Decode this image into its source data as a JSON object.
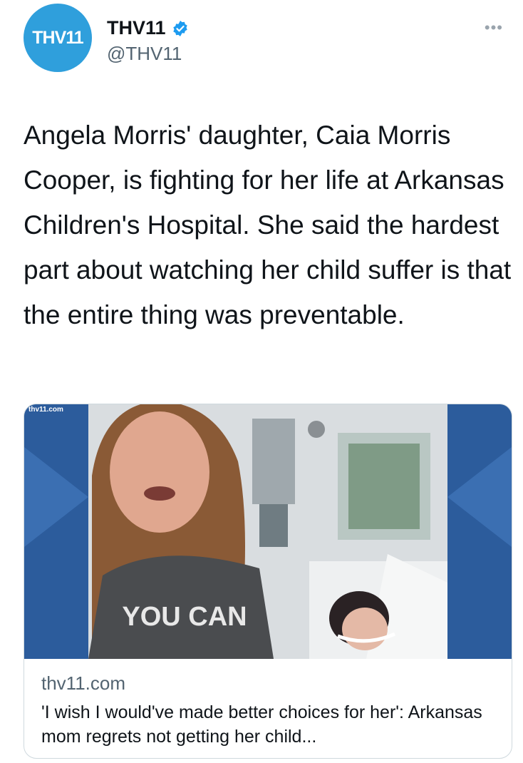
{
  "profile": {
    "avatar_text": "THV11",
    "display_name": "THV11",
    "handle": "@THV11",
    "verified": true,
    "more_label": "•••"
  },
  "tweet": {
    "text": "Angela Morris' daughter, Caia Morris Cooper, is fighting for her life at Arkansas Children's Hospital. She said the hardest part about watching her child suffer is that the entire thing was preventable."
  },
  "card": {
    "image_watermark": "thv11.com",
    "shirt_text": "YOU CAN",
    "domain": "thv11.com",
    "title": "'I wish I would've made better choices for her': Arkansas mom regrets not getting her child..."
  },
  "colors": {
    "brand_blue": "#2f9fdc",
    "verified_blue": "#1d9bf0",
    "card_bg_blue": "#2c5c9c"
  }
}
